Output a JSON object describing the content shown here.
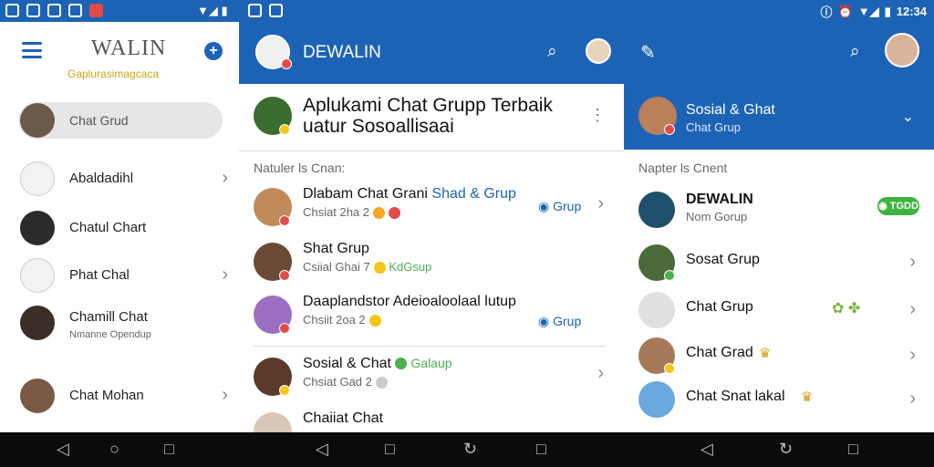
{
  "colors": {
    "accent": "#1d63b5",
    "badge_green": "#3fb33f",
    "tagline_gold": "#c9a71a"
  },
  "status": {
    "time": "12:34",
    "signal_icon": "signal-icon",
    "battery_icon": "battery-icon"
  },
  "left": {
    "logo": "WALIN",
    "tagline": "Gaplurasimagcaca",
    "active_item": "Chat Grud",
    "items": [
      {
        "label": "Abaldadihl",
        "sub": ""
      },
      {
        "label": "Chatul Chart",
        "sub": ""
      },
      {
        "label": "Phat Chal",
        "sub": ""
      },
      {
        "label": "Chamill Chat",
        "sub": "Nmanne Opendup"
      },
      {
        "label": "Chat Mohan",
        "sub": ""
      }
    ]
  },
  "middle": {
    "title": "DEWALIN",
    "banner": "Aplukami Chat Grupp Terbaik uatur Sosoallisaai",
    "section": "Natuler ls Cnan:",
    "rows": [
      {
        "name": "Dlabam Chat Grani",
        "name_hl": "Shad & Grup",
        "sub": "Chsiat 2ha 2",
        "badge": "Grup"
      },
      {
        "name": "Shat Grup",
        "sub": "Csiial Ghai 7",
        "sub_hl": "KdGsup",
        "badge": ""
      },
      {
        "name": "Daaplandstor Adeioaloolaal lutup",
        "sub": "Chsiit 2oa 2",
        "badge": "Grup"
      },
      {
        "name": "Sosial & Chat",
        "name_green": "Galaup",
        "sub": "Chsiat Gad 2",
        "badge": ""
      },
      {
        "name": "Chaiiat Chat",
        "sub": "",
        "badge": ""
      }
    ]
  },
  "right": {
    "group_title": "Sosial & Ghat",
    "group_sub": "Chat Grup",
    "section": "Napter ls Cnent",
    "rows": [
      {
        "name": "DEWALIN",
        "sub": "Nom Gorup",
        "tag": "TGDD"
      },
      {
        "name": "Sosat Grup",
        "sub": ""
      },
      {
        "name": "Chat Grup",
        "sub": ""
      },
      {
        "name": "Chat Grad",
        "sub": ""
      },
      {
        "name": "Chat Snat lakal",
        "sub": ""
      }
    ]
  },
  "nav": {
    "back": "◁",
    "home": "○",
    "recents": "□"
  }
}
